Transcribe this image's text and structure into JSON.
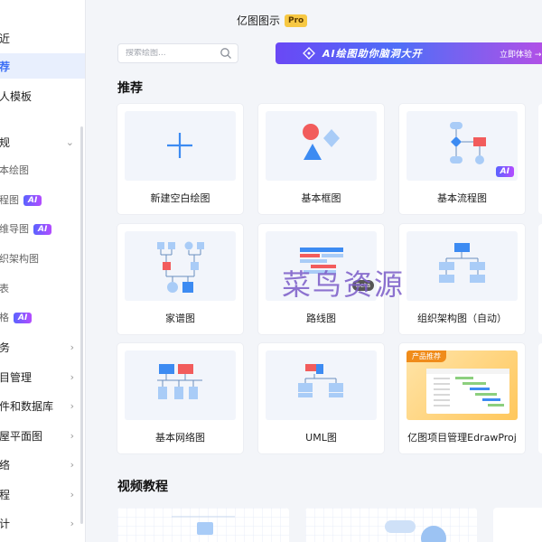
{
  "app": {
    "title": "亿图图示",
    "badge": "Pro"
  },
  "sidebar": {
    "items": [
      {
        "label": "近",
        "type": "top"
      },
      {
        "label": "荐",
        "type": "top",
        "active": true
      },
      {
        "label": "人模板",
        "type": "top"
      },
      {
        "label": "规",
        "type": "group",
        "expanded": true
      },
      {
        "label": "本绘图",
        "type": "sub"
      },
      {
        "label": "程图",
        "type": "sub",
        "ai": "AI"
      },
      {
        "label": "维导图",
        "type": "sub",
        "ai": "AI"
      },
      {
        "label": "织架构图",
        "type": "sub"
      },
      {
        "label": "表",
        "type": "sub"
      },
      {
        "label": "格",
        "type": "sub",
        "ai": "AI"
      },
      {
        "label": "务",
        "type": "group"
      },
      {
        "label": "目管理",
        "type": "group"
      },
      {
        "label": "件和数据库",
        "type": "group"
      },
      {
        "label": "屋平面图",
        "type": "group"
      },
      {
        "label": "络",
        "type": "group"
      },
      {
        "label": "程",
        "type": "group"
      },
      {
        "label": "计",
        "type": "group"
      }
    ]
  },
  "search": {
    "placeholder": "搜索绘图..."
  },
  "banner": {
    "text": "AI绘图助你脑洞大开",
    "cta": "立即体验 →"
  },
  "sections": {
    "recommend": "推荐",
    "video": "视频教程"
  },
  "cards": [
    {
      "label": "新建空白绘图"
    },
    {
      "label": "基本框图"
    },
    {
      "label": "基本流程图",
      "ai": "AI"
    },
    {
      "label": "家谱图"
    },
    {
      "label": "路线图",
      "beta": "Beta"
    },
    {
      "label": "组织架构图（自动）"
    },
    {
      "label": "基本网络图"
    },
    {
      "label": "UML图"
    },
    {
      "label": "亿图项目管理EdrawProj",
      "tag": "产品推荐"
    }
  ],
  "watermark": "菜鸟资源",
  "colors": {
    "accent": "#3b6ef5",
    "shape_red": "#f25c5c",
    "shape_blue": "#3d8bf2",
    "shape_light": "#a9ccf7",
    "orange": "#f08c1a"
  }
}
